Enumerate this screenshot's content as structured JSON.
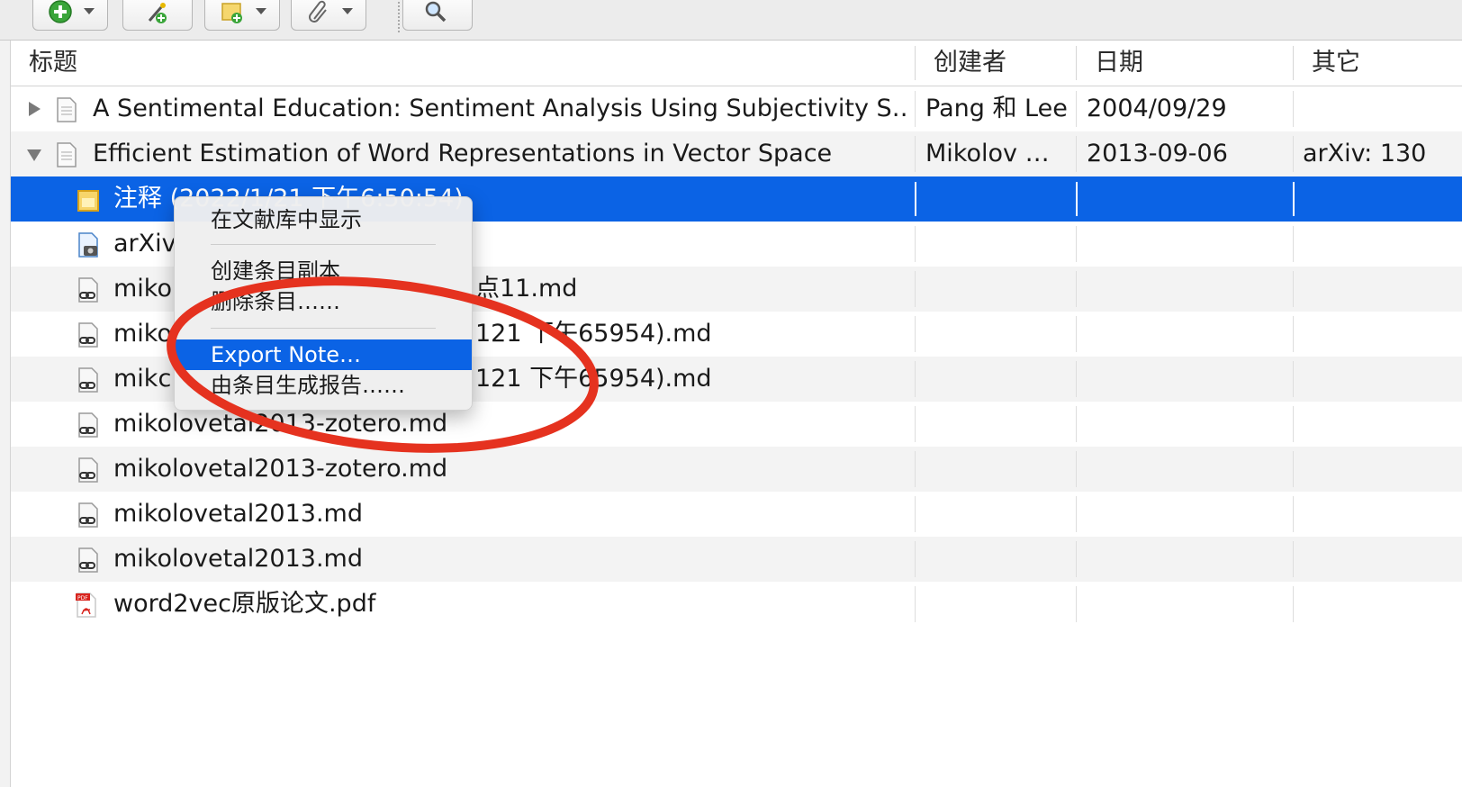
{
  "toolbar": {
    "buttons": [
      {
        "name": "new-item",
        "icon": "plus-circle-icon"
      },
      {
        "name": "add-by-identifier",
        "icon": "magic-wand-icon"
      },
      {
        "name": "new-note",
        "icon": "note-icon"
      },
      {
        "name": "add-attachment",
        "icon": "paperclip-icon"
      },
      {
        "name": "search",
        "icon": "search-icon"
      }
    ]
  },
  "columns": {
    "title": "标题",
    "creator": "创建者",
    "date": "日期",
    "extra": "其它"
  },
  "rows": [
    {
      "title": "A Sentimental Education: Sentiment Analysis Using Subjectivity S…",
      "creator": "Pang 和 Lee",
      "date": "2004/09/29",
      "extra": "",
      "icon": "document-icon",
      "expander": "collapsed"
    },
    {
      "title": "Efficient Estimation of Word Representations in Vector Space",
      "creator": "Mikolov …",
      "date": "2013-09-06",
      "extra": "arXiv: 130",
      "icon": "document-icon",
      "expander": "expanded"
    },
    {
      "title": "注释 (2022/1/21 下午6:50:54)",
      "creator": "",
      "date": "",
      "extra": "",
      "icon": "note-icon",
      "selected": true
    },
    {
      "title": "arXiv",
      "icon": "snapshot-icon"
    },
    {
      "title": "miko",
      "title_tail": "点11.md",
      "icon": "link-file-icon"
    },
    {
      "title": "miko",
      "title_tail": "121 下午65954).md",
      "icon": "link-file-icon"
    },
    {
      "title": "mikc",
      "title_tail": "121 下午65954).md",
      "icon": "link-file-icon"
    },
    {
      "title": "mikolovetal2013-zotero.md",
      "icon": "link-file-icon"
    },
    {
      "title": "mikolovetal2013-zotero.md",
      "icon": "link-file-icon"
    },
    {
      "title": "mikolovetal2013.md",
      "icon": "link-file-icon"
    },
    {
      "title": "mikolovetal2013.md",
      "icon": "link-file-icon"
    },
    {
      "title": "word2vec原版论文.pdf",
      "icon": "pdf-icon"
    }
  ],
  "context_menu": {
    "items": [
      {
        "label": "在文献库中显示"
      },
      {
        "label": "创建条目副本"
      },
      {
        "label": "删除条目……"
      },
      {
        "label": "Export Note…",
        "highlighted": true
      },
      {
        "label": "由条目生成报告……"
      }
    ]
  },
  "colors": {
    "selection": "#0b63e5",
    "annotation": "#e5321f"
  }
}
